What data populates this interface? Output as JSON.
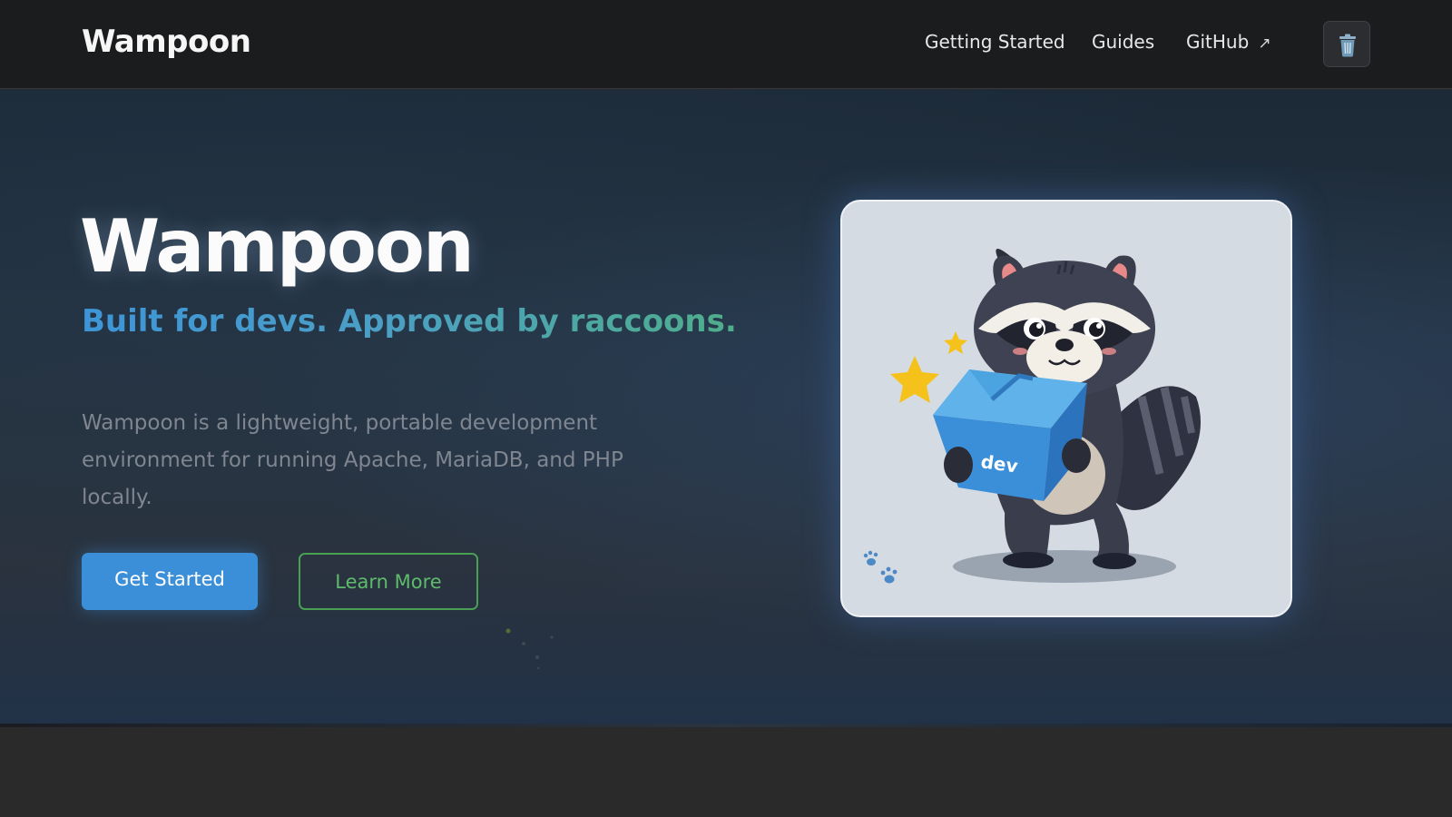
{
  "header": {
    "brand": "Wampoon",
    "nav": [
      {
        "label": "Getting Started"
      },
      {
        "label": "Guides"
      },
      {
        "label": "GitHub",
        "icon": "external-link-icon",
        "glyph": "↗"
      }
    ],
    "theme_button_icon": "trash-can-icon"
  },
  "hero": {
    "title": "Wampoon",
    "tagline": "Built for devs. Approved by raccoons.",
    "description": "Wampoon is a lightweight, portable development environment for running Apache, MariaDB, and PHP locally.",
    "primary_button": "Get Started",
    "secondary_button": "Learn More",
    "mascot": {
      "name": "raccoon-mascot-illustration",
      "box_label": "dev"
    }
  },
  "colors": {
    "header_bg": "#1b1c1e",
    "primary_button": "#3b8fd9",
    "secondary_outline": "#49a055",
    "tagline_start": "#3d95d8",
    "tagline_end": "#4fae8a",
    "card_bg": "#d5dbe2"
  }
}
